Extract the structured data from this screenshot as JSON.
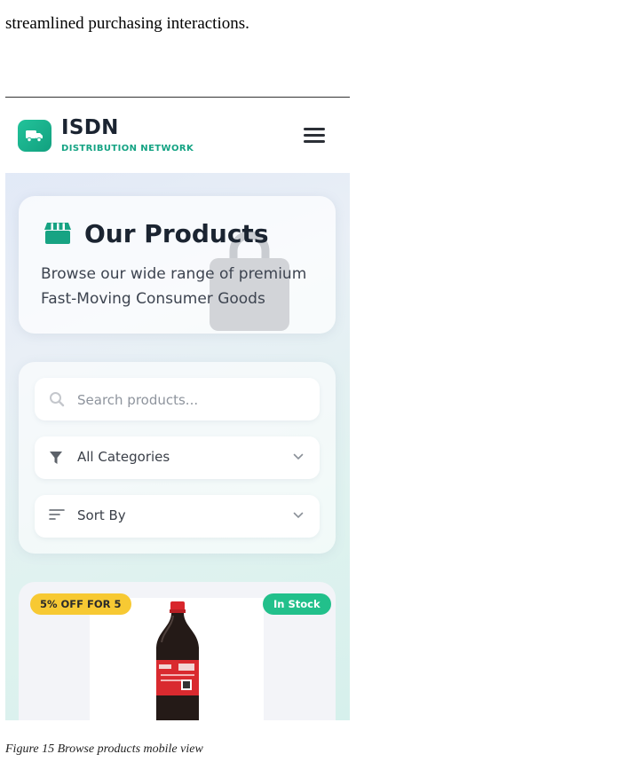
{
  "document": {
    "intro_line": "streamlined purchasing interactions.",
    "caption": "Figure 15 Browse products mobile view"
  },
  "header": {
    "brand_name": "ISDN",
    "brand_subtitle": "DISTRIBUTION NETWORK",
    "logo_icon": "truck-icon",
    "menu_icon": "hamburger-menu-icon"
  },
  "hero": {
    "title": "Our Products",
    "subtitle": "Browse our wide range of premium Fast-Moving Consumer Goods",
    "title_icon": "store-icon"
  },
  "filters": {
    "search_placeholder": "Search products...",
    "category_label": "All Categories",
    "sort_label": "Sort By"
  },
  "product": {
    "offer_badge": "5% OFF FOR 5",
    "stock_badge": "In Stock"
  },
  "colors": {
    "brand_green": "#14a383",
    "offer_yellow": "#f7c933",
    "stock_green": "#22c08b",
    "heading_dark": "#1b2431"
  }
}
